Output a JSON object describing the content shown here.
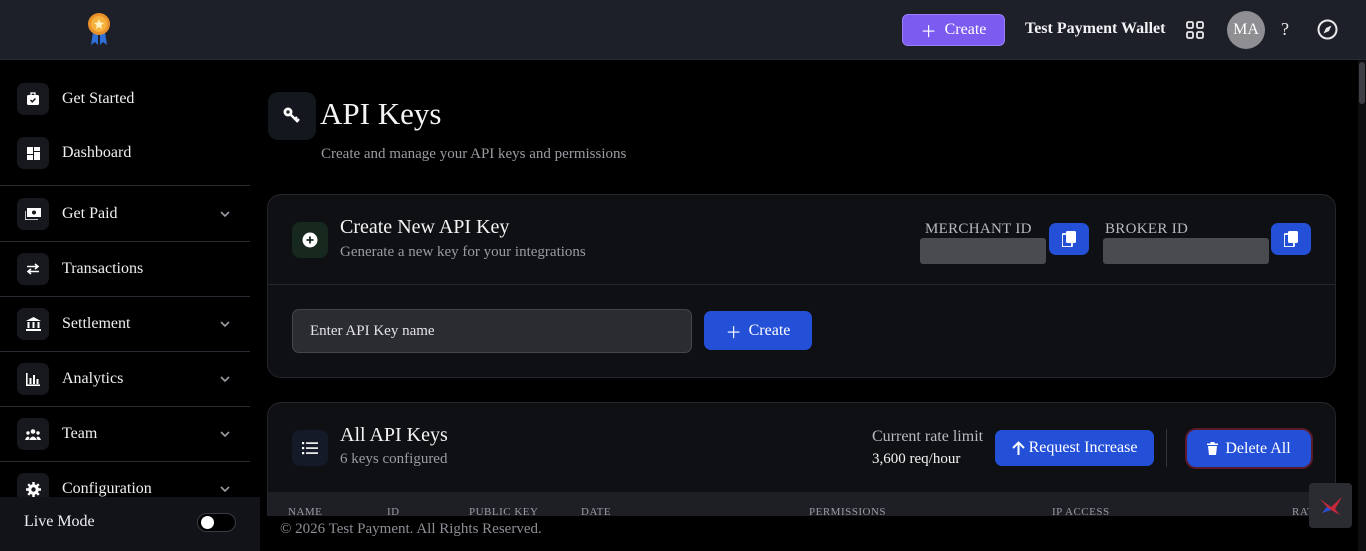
{
  "header": {
    "create_label": "Create",
    "wallet_name": "Test Payment Wallet",
    "avatar_initials": "MA",
    "help_label": "?"
  },
  "sidebar": {
    "items": [
      {
        "label": "Get Started"
      },
      {
        "label": "Dashboard"
      },
      {
        "label": "Get Paid"
      },
      {
        "label": "Transactions"
      },
      {
        "label": "Settlement"
      },
      {
        "label": "Analytics"
      },
      {
        "label": "Team"
      },
      {
        "label": "Configuration"
      }
    ],
    "live_mode_label": "Live Mode",
    "live_mode_on": false
  },
  "page": {
    "title": "API Keys",
    "subtitle": "Create and manage your API keys and permissions"
  },
  "create_card": {
    "title": "Create New API Key",
    "subtitle": "Generate a new key for your integrations",
    "merchant_id_label": "MERCHANT ID",
    "broker_id_label": "BROKER ID",
    "input_placeholder": "Enter API Key name",
    "create_label": "Create"
  },
  "keys_card": {
    "title": "All API Keys",
    "subtitle": "6 keys configured",
    "rate_limit_label": "Current rate limit",
    "rate_limit_value": "3,600 req/hour",
    "request_increase_label": "Request Increase",
    "delete_all_label": "Delete All",
    "columns": [
      "NAME",
      "ID",
      "PUBLIC KEY",
      "DATE",
      "PERMISSIONS",
      "IP ACCESS",
      "RATE"
    ]
  },
  "footer": {
    "copyright": "© 2026 Test Payment. All Rights Reserved."
  },
  "colors": {
    "accent_purple": "#7c5cf0",
    "primary_blue": "#2450d8",
    "background": "#000000",
    "topbar": "#1e2029"
  }
}
